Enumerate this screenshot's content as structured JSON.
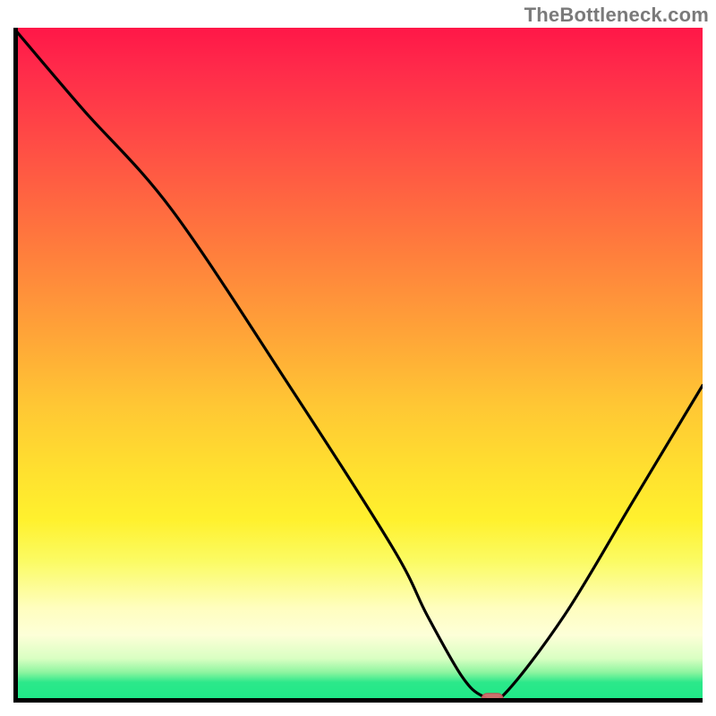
{
  "watermark": "TheBottleneck.com",
  "chart_data": {
    "type": "line",
    "title": "",
    "xlabel": "",
    "ylabel": "",
    "xlim": [
      0,
      100
    ],
    "ylim": [
      0,
      100
    ],
    "background_gradient": {
      "orientation": "vertical",
      "stops": [
        {
          "pos": 0,
          "color": "#ff1748",
          "meaning": "worst"
        },
        {
          "pos": 50,
          "color": "#ffb534",
          "meaning": "mid"
        },
        {
          "pos": 80,
          "color": "#fff12e",
          "meaning": "ok"
        },
        {
          "pos": 100,
          "color": "#1de787",
          "meaning": "best"
        }
      ]
    },
    "series": [
      {
        "name": "bottleneck-curve",
        "color": "#000000",
        "x": [
          0,
          10,
          23,
          40,
          55,
          60,
          65,
          68,
          71,
          80,
          90,
          100
        ],
        "y": [
          100,
          88,
          73,
          47,
          23,
          13,
          4,
          1,
          1,
          13,
          30,
          47
        ]
      }
    ],
    "marker": {
      "name": "optimal-point",
      "x": 69.5,
      "y": 0.5,
      "color": "#d46a6a",
      "shape": "rounded-rect"
    },
    "grid": false,
    "legend": false
  }
}
